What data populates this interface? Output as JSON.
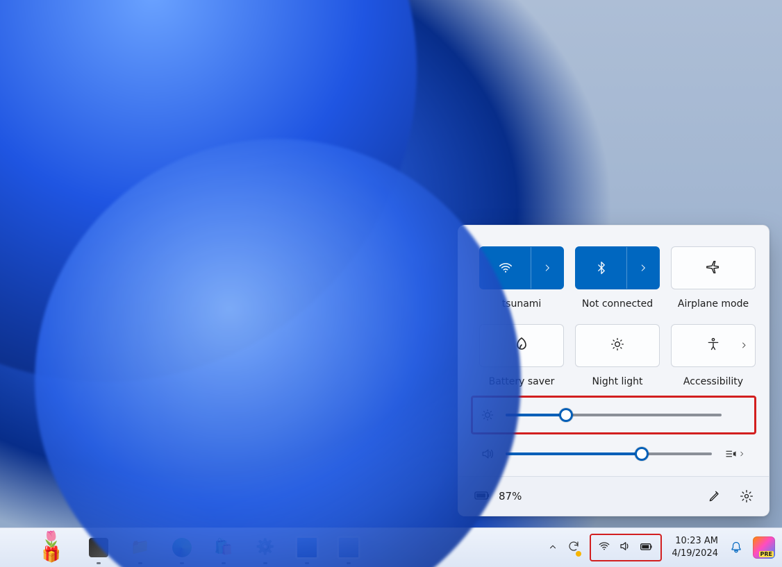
{
  "quick_settings": {
    "tiles": {
      "wifi": {
        "label": "tsunami",
        "active": true
      },
      "bluetooth": {
        "label": "Not connected",
        "active": true
      },
      "airplane": {
        "label": "Airplane mode",
        "active": false
      },
      "battery_saver": {
        "label": "Battery saver",
        "active": false
      },
      "night_light": {
        "label": "Night light",
        "active": false
      },
      "accessibility": {
        "label": "Accessibility",
        "active": false
      }
    },
    "sliders": {
      "brightness": {
        "percent": 28,
        "highlighted": true
      },
      "volume": {
        "percent": 66,
        "highlighted": false
      }
    },
    "footer": {
      "battery_text": "87%"
    }
  },
  "taskbar": {
    "tray": {
      "time": "10:23 AM",
      "date": "4/19/2024",
      "copilot_badge": "PRE",
      "system_icons_highlighted": true
    }
  }
}
